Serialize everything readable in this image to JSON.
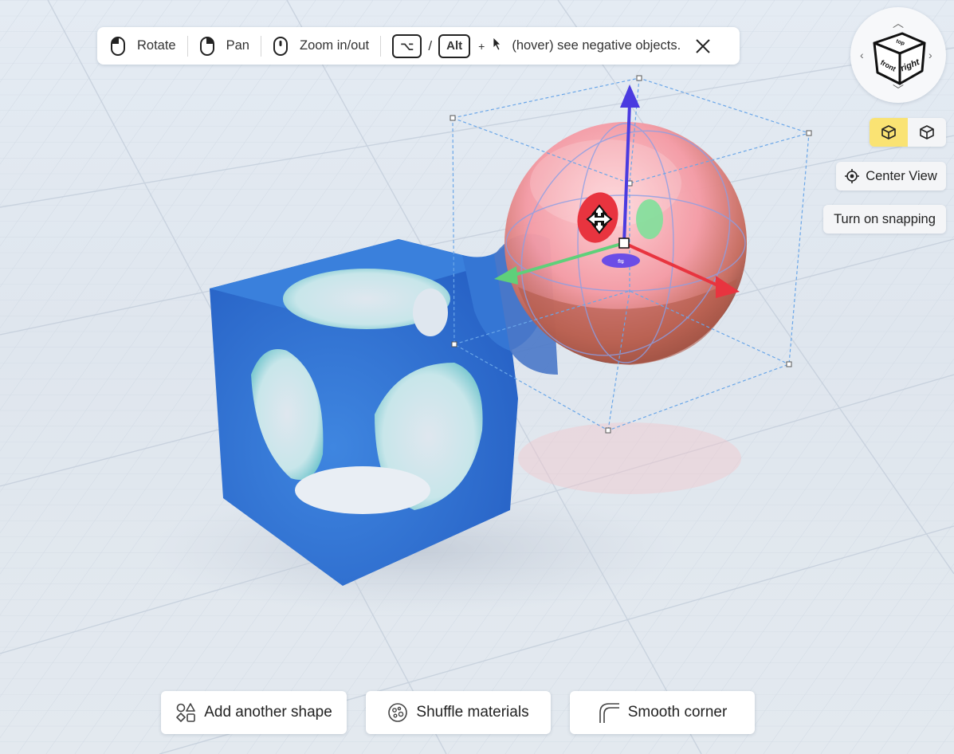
{
  "hint_bar": {
    "rotate_label": "Rotate",
    "pan_label": "Pan",
    "zoom_label": "Zoom in/out",
    "option_key": "⌥",
    "slash": "/",
    "alt_key": "Alt",
    "plus": "+",
    "hover_text": "(hover) see negative objects."
  },
  "nav_cube": {
    "front_label": "front",
    "right_label": "right",
    "top_label": "top"
  },
  "view_toggle": {
    "active": "solid-view",
    "options": [
      "solid-view-icon",
      "wireframe-view-icon"
    ]
  },
  "side_buttons": {
    "center_view_label": "Center View",
    "snapping_label": "Turn on snapping"
  },
  "bottom_bar": {
    "add_shape_label": "Add another shape",
    "shuffle_label": "Shuffle materials",
    "smooth_label": "Smooth corner"
  },
  "colors": {
    "accent_yellow": "#fae373",
    "cube_blue": "#2f72d0",
    "cube_inner": "#8fd3d8",
    "sphere_pink": "#f29aa3",
    "axis_x": "#e8343f",
    "axis_y": "#5fd07a",
    "axis_z": "#4a3be0"
  }
}
